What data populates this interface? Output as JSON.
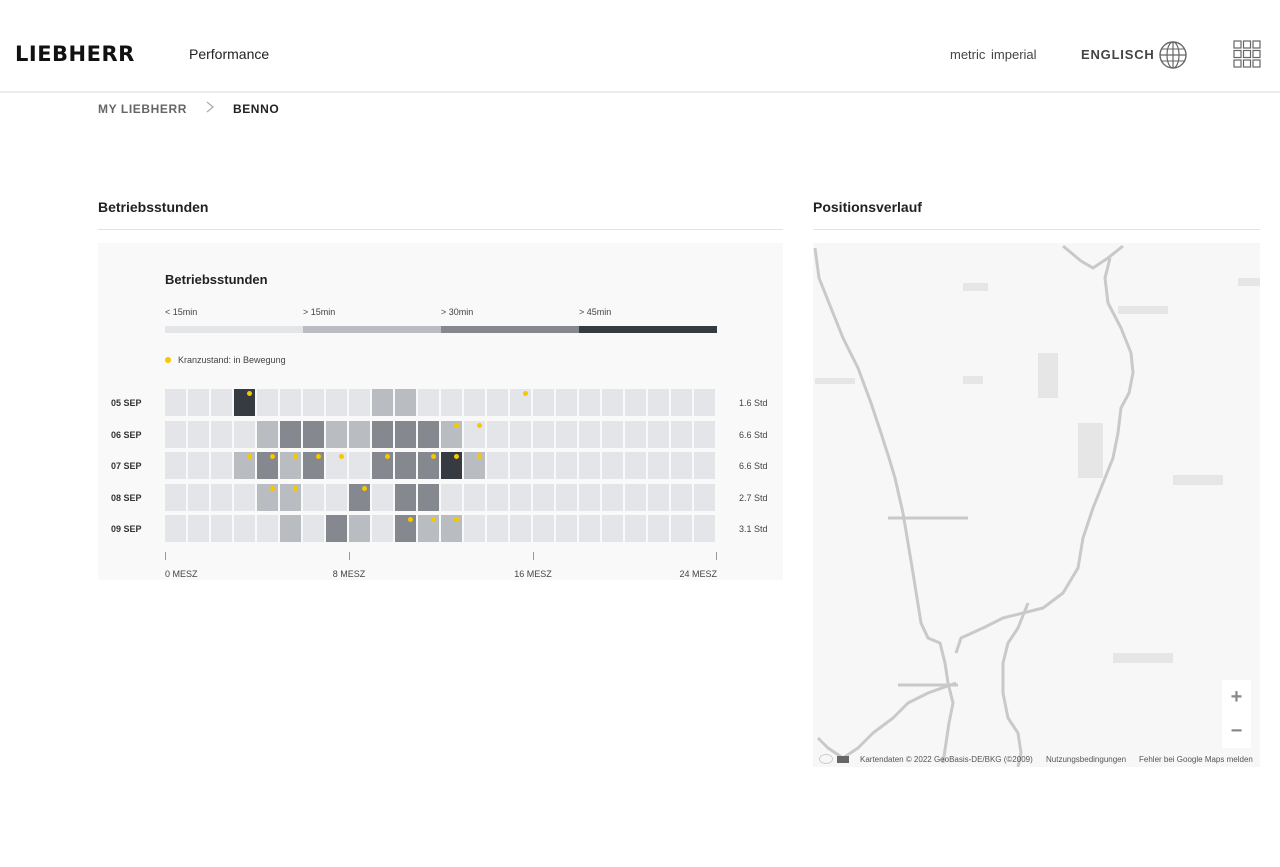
{
  "header": {
    "logo": "LIEBHERR",
    "app_name": "Performance",
    "units": {
      "metric": "metric",
      "imperial": "imperial"
    },
    "language": "ENGLISCH",
    "icons": {
      "language": "globe-icon",
      "apps": "app-grid-icon"
    }
  },
  "breadcrumb": {
    "items": [
      "MY LIEBHERR",
      "BENNO"
    ],
    "separator_icon": "chevron-right-icon"
  },
  "sections": {
    "operating_hours": {
      "title": "Betriebsstunden"
    },
    "position_history": {
      "title": "Positionsverlauf"
    }
  },
  "chart_data": {
    "type": "heatmap",
    "title": "Betriebsstunden",
    "legend": {
      "levels": [
        {
          "label": "< 15min",
          "color": "#e3e5e8"
        },
        {
          "label": "> 15min",
          "color": "#b9bcc1"
        },
        {
          "label": "> 30min",
          "color": "#85888e"
        },
        {
          "label": "> 45min",
          "color": "#363a41"
        }
      ],
      "marker": {
        "label": "Kranzustand: in Bewegung",
        "color": "#f5c800"
      }
    },
    "x_ticks": [
      {
        "hour": 0,
        "label": "0 MESZ"
      },
      {
        "hour": 8,
        "label": "8 MESZ"
      },
      {
        "hour": 16,
        "label": "16 MESZ"
      },
      {
        "hour": 24,
        "label": "24 MESZ"
      }
    ],
    "hours_per_day": 24,
    "rows": [
      {
        "day": "05 SEP",
        "total": "1.6 Std",
        "levels": [
          0,
          0,
          0,
          3,
          0,
          0,
          0,
          0,
          0,
          1,
          1,
          0,
          0,
          0,
          0,
          0,
          0,
          0,
          0,
          0,
          0,
          0,
          0,
          0
        ],
        "moving": [
          3,
          15
        ]
      },
      {
        "day": "06 SEP",
        "total": "6.6 Std",
        "levels": [
          0,
          0,
          0,
          0,
          1,
          2,
          2,
          1,
          1,
          2,
          2,
          2,
          1,
          0,
          0,
          0,
          0,
          0,
          0,
          0,
          0,
          0,
          0,
          0
        ],
        "moving": [
          12,
          13
        ]
      },
      {
        "day": "07 SEP",
        "total": "6.6 Std",
        "levels": [
          0,
          0,
          0,
          1,
          2,
          1,
          2,
          0,
          0,
          2,
          2,
          2,
          3,
          1,
          0,
          0,
          0,
          0,
          0,
          0,
          0,
          0,
          0,
          0
        ],
        "moving": [
          3,
          4,
          5,
          6,
          7,
          9,
          11,
          12,
          13
        ]
      },
      {
        "day": "08 SEP",
        "total": "2.7 Std",
        "levels": [
          0,
          0,
          0,
          0,
          1,
          1,
          0,
          0,
          2,
          0,
          2,
          2,
          0,
          0,
          0,
          0,
          0,
          0,
          0,
          0,
          0,
          0,
          0,
          0
        ],
        "moving": [
          4,
          5,
          8
        ]
      },
      {
        "day": "09 SEP",
        "total": "3.1 Std",
        "levels": [
          0,
          0,
          0,
          0,
          0,
          1,
          0,
          2,
          1,
          0,
          2,
          1,
          1,
          0,
          0,
          0,
          0,
          0,
          0,
          0,
          0,
          0,
          0,
          0
        ],
        "moving": [
          10,
          11,
          12
        ]
      }
    ]
  },
  "map": {
    "zoom_in": "+",
    "zoom_out": "−",
    "attribution": "Kartendaten © 2022 GeoBasis-DE/BKG (©2009)",
    "terms": "Nutzungsbedingungen",
    "report": "Fehler bei Google Maps melden"
  }
}
